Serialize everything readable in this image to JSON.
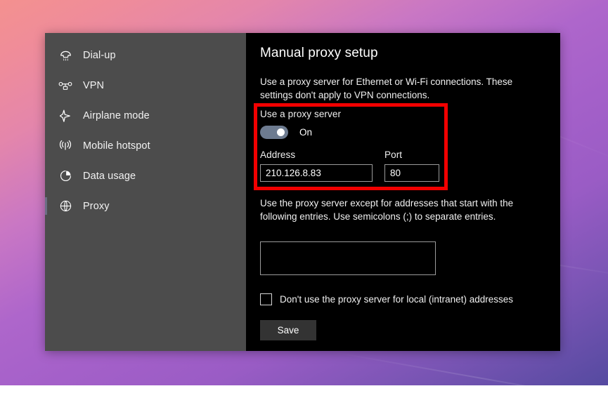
{
  "wallpaper": {
    "gradient_from": "#f4918f",
    "gradient_mid": "#a460c9",
    "gradient_to": "#554aa0"
  },
  "sidebar": {
    "items": [
      {
        "label": "Dial-up",
        "icon": "dialup-icon",
        "selected": false
      },
      {
        "label": "VPN",
        "icon": "vpn-icon",
        "selected": false
      },
      {
        "label": "Airplane mode",
        "icon": "airplane-icon",
        "selected": false
      },
      {
        "label": "Mobile hotspot",
        "icon": "hotspot-icon",
        "selected": false
      },
      {
        "label": "Data usage",
        "icon": "pie-chart-icon",
        "selected": false
      },
      {
        "label": "Proxy",
        "icon": "globe-icon",
        "selected": true
      }
    ]
  },
  "content": {
    "title": "Manual proxy setup",
    "description": "Use a proxy server for Ethernet or Wi-Fi connections. These settings don't apply to VPN connections.",
    "proxy": {
      "section_label": "Use a proxy server",
      "toggle_state": "On",
      "toggle_on": true,
      "address_label": "Address",
      "address_value": "210.126.8.83",
      "address_placeholder": "",
      "port_label": "Port",
      "port_value": "80",
      "port_placeholder": "",
      "highlight_color": "#f20000"
    },
    "exceptions": {
      "description": "Use the proxy server except for addresses that start with the following entries. Use semicolons (;) to separate entries.",
      "value": "",
      "placeholder": ""
    },
    "local_bypass": {
      "label": "Don't use the proxy server for local (intranet) addresses",
      "checked": false
    },
    "save_label": "Save"
  }
}
